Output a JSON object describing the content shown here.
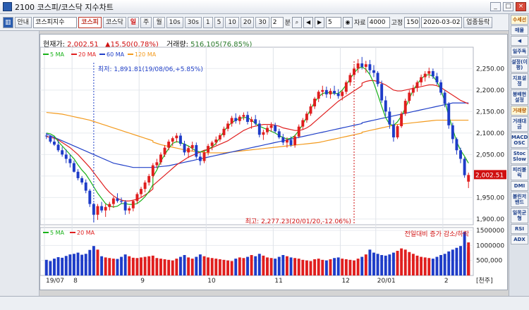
{
  "window": {
    "title": "2100 코스피/코스닥 지수차트",
    "controls": [
      "_",
      "□",
      "×"
    ]
  },
  "toolbar": {
    "info_label": "안내",
    "index_name": "코스피지수",
    "market_tabs": [
      "코스피",
      "코스닥"
    ],
    "period_buttons": [
      "일",
      "주",
      "월",
      "10s",
      "30s",
      "1",
      "5",
      "10",
      "20",
      "30"
    ],
    "period_active": "일",
    "count_value": "2",
    "count_unit": "분",
    "span_value": "5",
    "data_label": "자료",
    "data_value": "4000",
    "fixed_label": "고정",
    "fixed_value": "150",
    "date_value": "2020-03-02",
    "updown_label": "업종등락"
  },
  "info": {
    "price_label": "현재가:",
    "price_value": "2,002.51",
    "change_value": "▲15.50(0.78%)",
    "volume_label": "거래량:",
    "volume_value": "516,105(76.85%)"
  },
  "legend": [
    {
      "label": "5 MA",
      "color": "#19b219"
    },
    {
      "label": "20 MA",
      "color": "#e02020"
    },
    {
      "label": "60 MA",
      "color": "#2140c8"
    },
    {
      "label": "120 MA",
      "color": "#f39a1d"
    }
  ],
  "volume_legend": [
    {
      "label": "5 MA",
      "color": "#19b219"
    },
    {
      "label": "20 MA",
      "color": "#e02020"
    }
  ],
  "annotations": {
    "low": "최저: 1,891.81(19/08/06,+5.85%)",
    "high": "최고: 2,277.23(20/01/20,-12.06%)",
    "volume_note": "전일대비 증가 감소/하락"
  },
  "axis_unit": "[천주]",
  "right_panel": [
    "수세선",
    "매물",
    "◀",
    "일주독",
    "설정(이평)",
    "지표설정",
    "봉배현설정",
    "거래량",
    "거래대금",
    "MACD OSC",
    "Stoc Slow",
    "피리볼릭",
    "DMI",
    "볼린저밴드",
    "일목균형",
    "RSI",
    "ADX"
  ],
  "chart_data": {
    "type": "candlestick",
    "x_labels": [
      "19/07",
      "8",
      "9",
      "10",
      "11",
      "12",
      "20/01",
      "2"
    ],
    "y_ticks": [
      1900,
      1950,
      2000,
      2050,
      2100,
      2150,
      2200,
      2250
    ],
    "y_tick_labels": [
      "1,900.00",
      "1,950.00",
      "2,000.00",
      "2,050.00",
      "2,100.00",
      "2,150.00",
      "2,200.00",
      "2,250.00"
    ],
    "ylim": [
      1890,
      2280
    ],
    "current_price_label": "2,002.51",
    "current_price": 2002.51,
    "volume_ticks": [
      500000,
      1000000,
      1500000
    ],
    "volume_tick_labels": [
      "500,000",
      "1000000",
      "1500000"
    ],
    "volume_ylim": [
      0,
      1500000
    ],
    "candles": [
      {
        "o": 2094,
        "h": 2100,
        "l": 2086,
        "c": 2093
      },
      {
        "o": 2093,
        "h": 2095,
        "l": 2076,
        "c": 2080
      },
      {
        "o": 2080,
        "h": 2090,
        "l": 2070,
        "c": 2073
      },
      {
        "o": 2073,
        "h": 2083,
        "l": 2056,
        "c": 2060
      },
      {
        "o": 2060,
        "h": 2068,
        "l": 2045,
        "c": 2050
      },
      {
        "o": 2050,
        "h": 2062,
        "l": 2030,
        "c": 2040
      },
      {
        "o": 2040,
        "h": 2050,
        "l": 2020,
        "c": 2030
      },
      {
        "o": 2030,
        "h": 2036,
        "l": 2008,
        "c": 2010
      },
      {
        "o": 2010,
        "h": 2016,
        "l": 1990,
        "c": 1995
      },
      {
        "o": 1995,
        "h": 2000,
        "l": 1980,
        "c": 1985
      },
      {
        "o": 1985,
        "h": 1992,
        "l": 1960,
        "c": 1966
      },
      {
        "o": 1966,
        "h": 1970,
        "l": 1928,
        "c": 1935
      },
      {
        "o": 1935,
        "h": 1938,
        "l": 1892,
        "c": 1910
      },
      {
        "o": 1910,
        "h": 1935,
        "l": 1898,
        "c": 1930
      },
      {
        "o": 1930,
        "h": 1940,
        "l": 1915,
        "c": 1920
      },
      {
        "o": 1920,
        "h": 1935,
        "l": 1905,
        "c": 1928
      },
      {
        "o": 1928,
        "h": 1940,
        "l": 1920,
        "c": 1935
      },
      {
        "o": 1935,
        "h": 1952,
        "l": 1926,
        "c": 1948
      },
      {
        "o": 1948,
        "h": 1960,
        "l": 1938,
        "c": 1942
      },
      {
        "o": 1942,
        "h": 1950,
        "l": 1935,
        "c": 1940
      },
      {
        "o": 1940,
        "h": 1944,
        "l": 1910,
        "c": 1920
      },
      {
        "o": 1920,
        "h": 1930,
        "l": 1912,
        "c": 1925
      },
      {
        "o": 1925,
        "h": 1945,
        "l": 1918,
        "c": 1942
      },
      {
        "o": 1942,
        "h": 1962,
        "l": 1935,
        "c": 1958
      },
      {
        "o": 1958,
        "h": 1975,
        "l": 1950,
        "c": 1970
      },
      {
        "o": 1970,
        "h": 1990,
        "l": 1962,
        "c": 1985
      },
      {
        "o": 1985,
        "h": 2005,
        "l": 1978,
        "c": 2000
      },
      {
        "o": 2000,
        "h": 2030,
        "l": 1995,
        "c": 2025
      },
      {
        "o": 2025,
        "h": 2040,
        "l": 2018,
        "c": 2032
      },
      {
        "o": 2032,
        "h": 2055,
        "l": 2026,
        "c": 2050
      },
      {
        "o": 2050,
        "h": 2072,
        "l": 2044,
        "c": 2066
      },
      {
        "o": 2066,
        "h": 2085,
        "l": 2060,
        "c": 2080
      },
      {
        "o": 2080,
        "h": 2092,
        "l": 2070,
        "c": 2088
      },
      {
        "o": 2088,
        "h": 2100,
        "l": 2078,
        "c": 2094
      },
      {
        "o": 2094,
        "h": 2100,
        "l": 2070,
        "c": 2075
      },
      {
        "o": 2075,
        "h": 2082,
        "l": 2048,
        "c": 2055
      },
      {
        "o": 2055,
        "h": 2070,
        "l": 2042,
        "c": 2065
      },
      {
        "o": 2065,
        "h": 2080,
        "l": 2058,
        "c": 2072
      },
      {
        "o": 2072,
        "h": 2078,
        "l": 2040,
        "c": 2045
      },
      {
        "o": 2045,
        "h": 2056,
        "l": 2025,
        "c": 2035
      },
      {
        "o": 2035,
        "h": 2060,
        "l": 2030,
        "c": 2055
      },
      {
        "o": 2055,
        "h": 2075,
        "l": 2048,
        "c": 2070
      },
      {
        "o": 2070,
        "h": 2082,
        "l": 2060,
        "c": 2078
      },
      {
        "o": 2078,
        "h": 2092,
        "l": 2072,
        "c": 2085
      },
      {
        "o": 2085,
        "h": 2100,
        "l": 2080,
        "c": 2095
      },
      {
        "o": 2095,
        "h": 2115,
        "l": 2090,
        "c": 2110
      },
      {
        "o": 2110,
        "h": 2128,
        "l": 2104,
        "c": 2122
      },
      {
        "o": 2122,
        "h": 2140,
        "l": 2115,
        "c": 2135
      },
      {
        "o": 2135,
        "h": 2146,
        "l": 2122,
        "c": 2128
      },
      {
        "o": 2128,
        "h": 2142,
        "l": 2120,
        "c": 2138
      },
      {
        "o": 2138,
        "h": 2148,
        "l": 2130,
        "c": 2142
      },
      {
        "o": 2142,
        "h": 2150,
        "l": 2120,
        "c": 2126
      },
      {
        "o": 2126,
        "h": 2138,
        "l": 2110,
        "c": 2132
      },
      {
        "o": 2132,
        "h": 2142,
        "l": 2118,
        "c": 2122
      },
      {
        "o": 2122,
        "h": 2130,
        "l": 2090,
        "c": 2096
      },
      {
        "o": 2096,
        "h": 2108,
        "l": 2084,
        "c": 2102
      },
      {
        "o": 2102,
        "h": 2118,
        "l": 2096,
        "c": 2112
      },
      {
        "o": 2112,
        "h": 2125,
        "l": 2104,
        "c": 2118
      },
      {
        "o": 2118,
        "h": 2124,
        "l": 2100,
        "c": 2104
      },
      {
        "o": 2104,
        "h": 2110,
        "l": 2086,
        "c": 2090
      },
      {
        "o": 2090,
        "h": 2098,
        "l": 2072,
        "c": 2078
      },
      {
        "o": 2078,
        "h": 2090,
        "l": 2066,
        "c": 2084
      },
      {
        "o": 2084,
        "h": 2092,
        "l": 2068,
        "c": 2072
      },
      {
        "o": 2072,
        "h": 2096,
        "l": 2066,
        "c": 2092
      },
      {
        "o": 2092,
        "h": 2120,
        "l": 2088,
        "c": 2115
      },
      {
        "o": 2115,
        "h": 2135,
        "l": 2108,
        "c": 2130
      },
      {
        "o": 2130,
        "h": 2150,
        "l": 2124,
        "c": 2145
      },
      {
        "o": 2145,
        "h": 2168,
        "l": 2140,
        "c": 2162
      },
      {
        "o": 2162,
        "h": 2184,
        "l": 2156,
        "c": 2180
      },
      {
        "o": 2180,
        "h": 2200,
        "l": 2172,
        "c": 2196
      },
      {
        "o": 2196,
        "h": 2210,
        "l": 2186,
        "c": 2200
      },
      {
        "o": 2200,
        "h": 2208,
        "l": 2182,
        "c": 2190
      },
      {
        "o": 2190,
        "h": 2204,
        "l": 2180,
        "c": 2198
      },
      {
        "o": 2198,
        "h": 2210,
        "l": 2188,
        "c": 2192
      },
      {
        "o": 2192,
        "h": 2202,
        "l": 2180,
        "c": 2186
      },
      {
        "o": 2186,
        "h": 2200,
        "l": 2176,
        "c": 2196
      },
      {
        "o": 2196,
        "h": 2222,
        "l": 2190,
        "c": 2218
      },
      {
        "o": 2218,
        "h": 2240,
        "l": 2210,
        "c": 2235
      },
      {
        "o": 2235,
        "h": 2256,
        "l": 2228,
        "c": 2250
      },
      {
        "o": 2250,
        "h": 2272,
        "l": 2240,
        "c": 2262
      },
      {
        "o": 2262,
        "h": 2277,
        "l": 2248,
        "c": 2254
      },
      {
        "o": 2254,
        "h": 2268,
        "l": 2240,
        "c": 2260
      },
      {
        "o": 2260,
        "h": 2270,
        "l": 2238,
        "c": 2246
      },
      {
        "o": 2246,
        "h": 2258,
        "l": 2230,
        "c": 2240
      },
      {
        "o": 2240,
        "h": 2244,
        "l": 2208,
        "c": 2214
      },
      {
        "o": 2214,
        "h": 2222,
        "l": 2170,
        "c": 2176
      },
      {
        "o": 2176,
        "h": 2186,
        "l": 2140,
        "c": 2150
      },
      {
        "o": 2150,
        "h": 2160,
        "l": 2110,
        "c": 2120
      },
      {
        "o": 2120,
        "h": 2130,
        "l": 2080,
        "c": 2090
      },
      {
        "o": 2090,
        "h": 2120,
        "l": 2086,
        "c": 2116
      },
      {
        "o": 2116,
        "h": 2150,
        "l": 2112,
        "c": 2145
      },
      {
        "o": 2145,
        "h": 2180,
        "l": 2140,
        "c": 2175
      },
      {
        "o": 2175,
        "h": 2200,
        "l": 2168,
        "c": 2194
      },
      {
        "o": 2194,
        "h": 2212,
        "l": 2186,
        "c": 2205
      },
      {
        "o": 2205,
        "h": 2222,
        "l": 2196,
        "c": 2218
      },
      {
        "o": 2218,
        "h": 2236,
        "l": 2210,
        "c": 2230
      },
      {
        "o": 2230,
        "h": 2244,
        "l": 2220,
        "c": 2238
      },
      {
        "o": 2238,
        "h": 2252,
        "l": 2228,
        "c": 2244
      },
      {
        "o": 2244,
        "h": 2250,
        "l": 2226,
        "c": 2232
      },
      {
        "o": 2232,
        "h": 2240,
        "l": 2212,
        "c": 2218
      },
      {
        "o": 2218,
        "h": 2224,
        "l": 2188,
        "c": 2194
      },
      {
        "o": 2194,
        "h": 2200,
        "l": 2160,
        "c": 2168
      },
      {
        "o": 2168,
        "h": 2172,
        "l": 2110,
        "c": 2118
      },
      {
        "o": 2118,
        "h": 2124,
        "l": 2076,
        "c": 2086
      },
      {
        "o": 2086,
        "h": 2090,
        "l": 2050,
        "c": 2060
      },
      {
        "o": 2060,
        "h": 2066,
        "l": 2030,
        "c": 2040
      },
      {
        "o": 2040,
        "h": 2044,
        "l": 1996,
        "c": 2002
      },
      {
        "o": 1987,
        "h": 2008,
        "l": 1972,
        "c": 2002.51
      }
    ],
    "volume": [
      520,
      480,
      560,
      610,
      590,
      650,
      700,
      720,
      760,
      690,
      720,
      850,
      980,
      860,
      640,
      600,
      580,
      560,
      550,
      620,
      700,
      640,
      590,
      580,
      600,
      620,
      640,
      660,
      580,
      560,
      540,
      520,
      500,
      560,
      620,
      680,
      600,
      560,
      620,
      700,
      640,
      600,
      580,
      560,
      540,
      520,
      500,
      480,
      560,
      600,
      580,
      620,
      680,
      640,
      720,
      660,
      600,
      580,
      560,
      620,
      680,
      640,
      600,
      580,
      560,
      520,
      500,
      480,
      540,
      560,
      520,
      500,
      540,
      580,
      600,
      560,
      540,
      520,
      500,
      560,
      620,
      700,
      860,
      760,
      720,
      680,
      660,
      700,
      760,
      820,
      900,
      860,
      780,
      720,
      660,
      620,
      600,
      580,
      560,
      620,
      680,
      720,
      800,
      860,
      920,
      980,
      1450,
      1100,
      940,
      760,
      516
    ],
    "ma5": [
      2100,
      2098,
      2093,
      2080,
      2070,
      2060,
      2050,
      2040,
      2026,
      2014,
      2004,
      1990,
      1975,
      1960,
      1948,
      1936,
      1930,
      1928,
      1930,
      1936,
      1936,
      1934,
      1934,
      1936,
      1943,
      1952,
      1964,
      1980,
      1998,
      2014,
      2034,
      2050,
      2064,
      2076,
      2080,
      2078,
      2074,
      2070,
      2064,
      2058,
      2056,
      2058,
      2062,
      2068,
      2076,
      2090,
      2104,
      2116,
      2124,
      2130,
      2134,
      2136,
      2136,
      2130,
      2122,
      2116,
      2112,
      2108,
      2104,
      2100,
      2094,
      2090,
      2086,
      2088,
      2094,
      2106,
      2120,
      2138,
      2156,
      2172,
      2184,
      2192,
      2194,
      2194,
      2192,
      2192,
      2200,
      2212,
      2226,
      2240,
      2250,
      2254,
      2254,
      2248,
      2236,
      2216,
      2190,
      2162,
      2136,
      2120,
      2118,
      2126,
      2140,
      2158,
      2180,
      2200,
      2214,
      2226,
      2234,
      2236,
      2232,
      2220,
      2200,
      2174,
      2140,
      2110,
      2080,
      2060,
      2046,
      2030
    ],
    "ma20": [
      2092,
      2090,
      2088,
      2084,
      2078,
      2072,
      2066,
      2058,
      2050,
      2040,
      2030,
      2020,
      2008,
      1996,
      1984,
      1972,
      1962,
      1954,
      1948,
      1944,
      1942,
      1942,
      1944,
      1946,
      1950,
      1956,
      1962,
      1970,
      1978,
      1986,
      1994,
      2002,
      2010,
      2018,
      2026,
      2032,
      2038,
      2044,
      2048,
      2052,
      2056,
      2060,
      2062,
      2066,
      2070,
      2074,
      2078,
      2082,
      2088,
      2094,
      2100,
      2106,
      2110,
      2114,
      2116,
      2118,
      2120,
      2120,
      2120,
      2118,
      2116,
      2112,
      2110,
      2108,
      2106,
      2106,
      2108,
      2112,
      2118,
      2126,
      2134,
      2142,
      2150,
      2158,
      2166,
      2174,
      2180,
      2186,
      2192,
      2198,
      2204,
      2210,
      2216,
      2220,
      2222,
      2222,
      2220,
      2216,
      2212,
      2206,
      2200,
      2198,
      2198,
      2200,
      2202,
      2204,
      2206,
      2208,
      2210,
      2212,
      2212,
      2210,
      2206,
      2200,
      2194,
      2188,
      2182,
      2176,
      2172,
      2168
    ],
    "ma60": [
      2098,
      2094,
      2090,
      2086,
      2082,
      2078,
      2074,
      2070,
      2066,
      2062,
      2058,
      2054,
      2050,
      2046,
      2042,
      2038,
      2034,
      2030,
      2028,
      2026,
      2024,
      2022,
      2020,
      2020,
      2020,
      2020,
      2020,
      2020,
      2020,
      2021,
      2022,
      2023,
      2024,
      2026,
      2028,
      2030,
      2032,
      2034,
      2036,
      2038,
      2040,
      2042,
      2044,
      2046,
      2048,
      2050,
      2052,
      2054,
      2056,
      2058,
      2060,
      2062,
      2064,
      2066,
      2068,
      2070,
      2072,
      2074,
      2076,
      2078,
      2080,
      2082,
      2084,
      2086,
      2088,
      2090,
      2092,
      2094,
      2096,
      2098,
      2100,
      2102,
      2104,
      2106,
      2108,
      2110,
      2112,
      2114,
      2116,
      2118,
      2120,
      2122,
      2124,
      2126,
      2128,
      2130,
      2132,
      2134,
      2136,
      2138,
      2140,
      2142,
      2144,
      2146,
      2148,
      2150,
      2152,
      2154,
      2156,
      2158,
      2160,
      2162,
      2164,
      2166,
      2168,
      2170,
      2170,
      2170,
      2170,
      2170
    ],
    "ma120": [
      2148,
      2147,
      2146,
      2145,
      2144,
      2142,
      2140,
      2138,
      2136,
      2134,
      2132,
      2130,
      2127,
      2124,
      2121,
      2118,
      2115,
      2112,
      2109,
      2106,
      2103,
      2100,
      2097,
      2094,
      2091,
      2088,
      2085,
      2082,
      2079,
      2076,
      2073,
      2071,
      2069,
      2067,
      2065,
      2063,
      2061,
      2059,
      2058,
      2057,
      2056,
      2055,
      2054,
      2054,
      2054,
      2054,
      2054,
      2055,
      2056,
      2057,
      2058,
      2059,
      2060,
      2061,
      2062,
      2063,
      2064,
      2065,
      2066,
      2067,
      2068,
      2069,
      2070,
      2071,
      2072,
      2073,
      2074,
      2075,
      2076,
      2077,
      2078,
      2080,
      2082,
      2084,
      2086,
      2088,
      2090,
      2092,
      2094,
      2096,
      2098,
      2100,
      2102,
      2104,
      2106,
      2108,
      2110,
      2112,
      2114,
      2116,
      2118,
      2120,
      2121,
      2122,
      2123,
      2124,
      2125,
      2126,
      2127,
      2128,
      2129,
      2130,
      2130,
      2130,
      2130,
      2130,
      2130,
      2130,
      2130,
      2130
    ]
  }
}
